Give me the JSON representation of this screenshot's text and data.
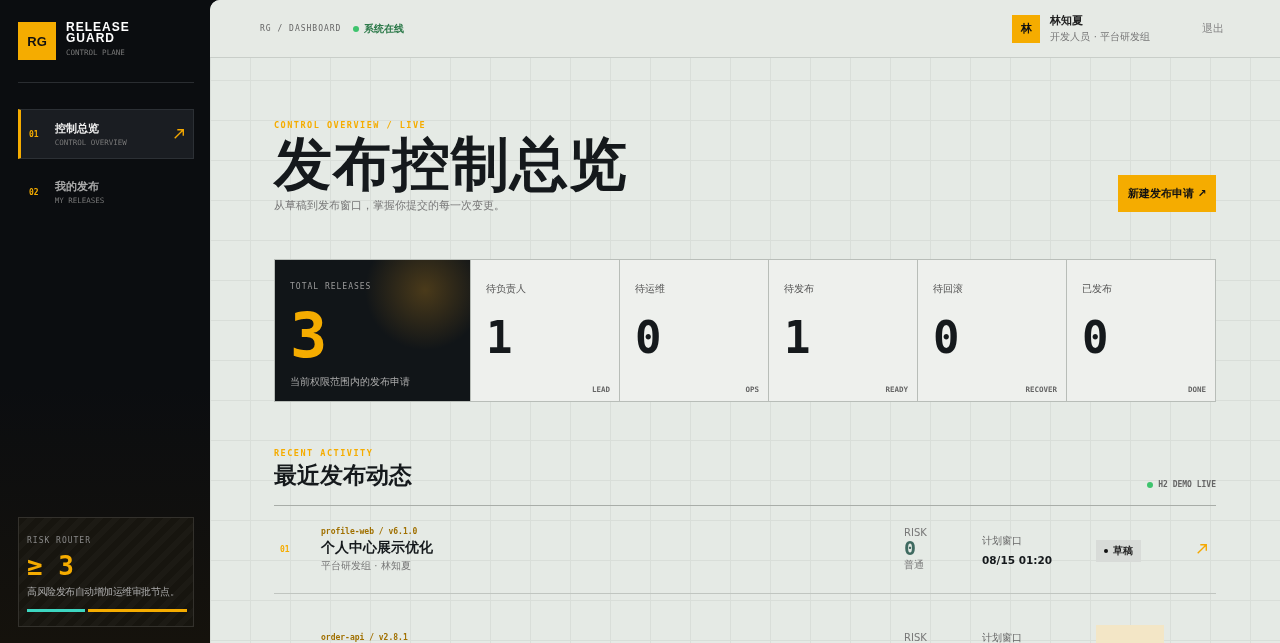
{
  "brand": {
    "mark": "RG",
    "name_line1": "RELEASE",
    "name_line2": "GUARD",
    "subtitle": "CONTROL PLANE"
  },
  "sidebar": {
    "items": [
      {
        "number": "01",
        "label": "控制总览",
        "sublabel": "CONTROL OVERVIEW",
        "selected": true
      },
      {
        "number": "02",
        "label": "我的发布",
        "sublabel": "MY RELEASES",
        "selected": false
      }
    ],
    "risk_card": {
      "title": "RISK ROUTER",
      "value": "≥ 3",
      "description": "高风险发布自动增加运维审批节点。"
    }
  },
  "topbar": {
    "breadcrumb": "RG / DASHBOARD",
    "status": "系统在线",
    "user": {
      "avatar": "林",
      "name": "林知夏",
      "role": "开发人员 · 平台研发组"
    },
    "logout": "退出"
  },
  "hero": {
    "eyebrow": "CONTROL OVERVIEW / LIVE",
    "title": "发布控制总览",
    "subtitle": "从草稿到发布窗口，掌握你提交的每一次变更。",
    "action": "新建发布申请 ↗"
  },
  "stats": {
    "total": {
      "label": "TOTAL RELEASES",
      "value": "3",
      "caption": "当前权限范围内的发布申请"
    },
    "items": [
      {
        "label": "待负责人",
        "value": "1",
        "tag": "LEAD"
      },
      {
        "label": "待运维",
        "value": "0",
        "tag": "OPS"
      },
      {
        "label": "待发布",
        "value": "1",
        "tag": "READY"
      },
      {
        "label": "待回滚",
        "value": "0",
        "tag": "RECOVER"
      },
      {
        "label": "已发布",
        "value": "0",
        "tag": "DONE"
      }
    ]
  },
  "activity": {
    "eyebrow": "RECENT ACTIVITY",
    "title": "最近发布动态",
    "live": "H2 DEMO LIVE",
    "rows": [
      {
        "number": "01",
        "slug": "profile-web / v6.1.0",
        "title": "个人中心展示优化",
        "meta": "平台研发组 · 林知夏",
        "risk_label": "RISK",
        "risk_value": "0",
        "risk_level": "普通",
        "window_label": "计划窗口",
        "window_value": "08/15 01:20",
        "status": "草稿",
        "color": "#d8dbd8"
      },
      {
        "slug": "order-api / v2.8.1",
        "risk_label": "RISK",
        "window_label": "计划窗口",
        "color": "#f3e6c6"
      }
    ]
  }
}
